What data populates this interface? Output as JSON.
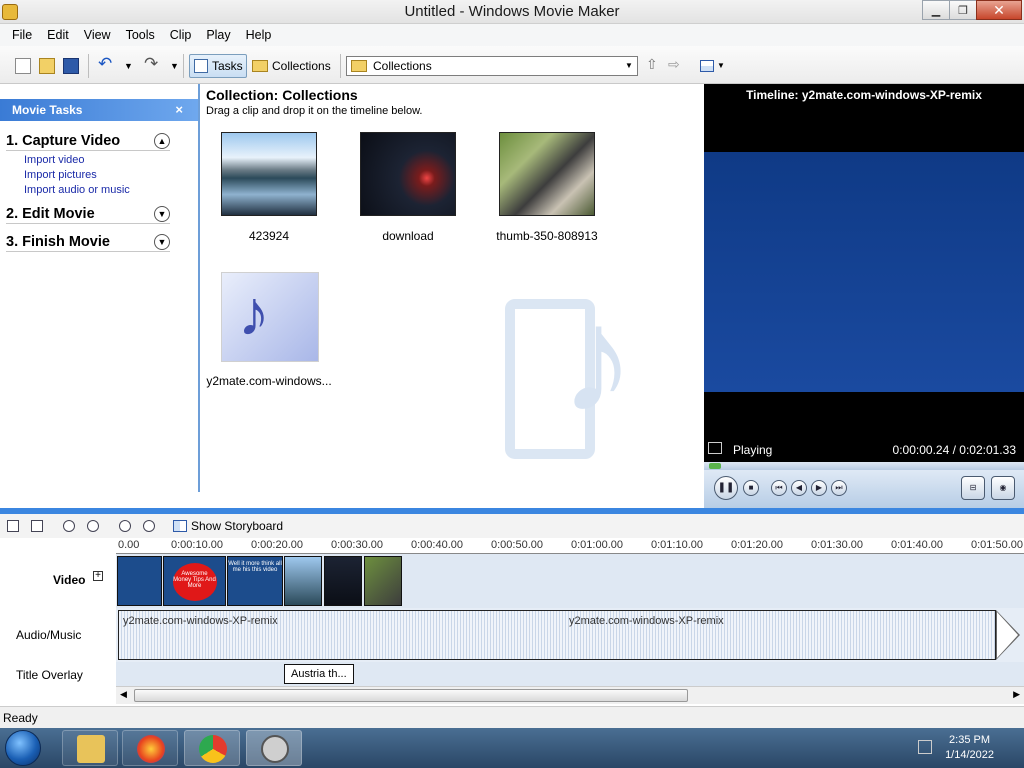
{
  "window": {
    "title": "Untitled - Windows Movie Maker"
  },
  "menu": [
    "File",
    "Edit",
    "View",
    "Tools",
    "Clip",
    "Play",
    "Help"
  ],
  "toolbar": {
    "tasks_label": "Tasks",
    "collections_label": "Collections",
    "collection_select": "Collections"
  },
  "tasks": {
    "header": "Movie Tasks",
    "sections": [
      {
        "label": "1. Capture Video",
        "links": [
          "Import video",
          "Import pictures",
          "Import audio or music"
        ]
      },
      {
        "label": "2. Edit Movie",
        "links": []
      },
      {
        "label": "3. Finish Movie",
        "links": []
      }
    ]
  },
  "collection": {
    "title": "Collection: Collections",
    "subtitle": "Drag a clip and drop it on the timeline below.",
    "items": [
      "423924",
      "download",
      "thumb-350-808913",
      "y2mate.com-windows..."
    ]
  },
  "preview": {
    "title": "Timeline: y2mate.com-windows-XP-remix",
    "status": "Playing",
    "time": "0:00:00.24 / 0:02:01.33",
    "progress_fraction": 0.002
  },
  "timeline": {
    "show_storyboard": "Show Storyboard",
    "ticks": [
      "0.00",
      "0:00:10.00",
      "0:00:20.00",
      "0:00:30.00",
      "0:00:40.00",
      "0:00:50.00",
      "0:01:00.00",
      "0:01:10.00",
      "0:01:20.00",
      "0:01:30.00",
      "0:01:40.00",
      "0:01:50.00"
    ],
    "video_label": "Video",
    "audio_label": "Audio/Music",
    "title_label": "Title Overlay",
    "audio_clip_label": "y2mate.com-windows-XP-remix",
    "title_clip": "Austria th...",
    "clip_texts": [
      "Well it more think all me his this video"
    ],
    "badge_texts": [
      "Awesome Money Tips And More"
    ]
  },
  "status": "Ready",
  "taskbar": {
    "time": "2:35 PM",
    "date": "1/14/2022"
  },
  "colors": {
    "accent": "#3b86e0",
    "preview_video": "#1a4aa0"
  }
}
